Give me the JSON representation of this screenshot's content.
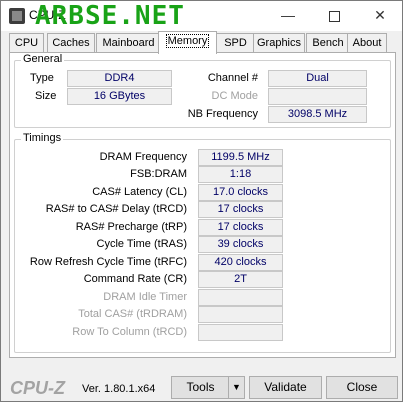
{
  "window": {
    "title": "CPU-Z",
    "watermark": "ARBSE.NET",
    "controls": {
      "minimize": "—",
      "close": "✕"
    }
  },
  "tabs": [
    {
      "label": "CPU"
    },
    {
      "label": "Caches"
    },
    {
      "label": "Mainboard"
    },
    {
      "label": "Memory"
    },
    {
      "label": "SPD"
    },
    {
      "label": "Graphics"
    },
    {
      "label": "Bench"
    },
    {
      "label": "About"
    }
  ],
  "active_tab": "Memory",
  "general": {
    "title": "General",
    "type_label": "Type",
    "type_value": "DDR4",
    "size_label": "Size",
    "size_value": "16 GBytes",
    "channel_label": "Channel #",
    "channel_value": "Dual",
    "dcmode_label": "DC Mode",
    "dcmode_value": "",
    "nbfreq_label": "NB Frequency",
    "nbfreq_value": "3098.5 MHz"
  },
  "timings": {
    "title": "Timings",
    "rows": [
      {
        "label": "DRAM Frequency",
        "value": "1199.5 MHz",
        "enabled": true
      },
      {
        "label": "FSB:DRAM",
        "value": "1:18",
        "enabled": true
      },
      {
        "label": "CAS# Latency (CL)",
        "value": "17.0 clocks",
        "enabled": true
      },
      {
        "label": "RAS# to CAS# Delay (tRCD)",
        "value": "17 clocks",
        "enabled": true
      },
      {
        "label": "RAS# Precharge (tRP)",
        "value": "17 clocks",
        "enabled": true
      },
      {
        "label": "Cycle Time (tRAS)",
        "value": "39 clocks",
        "enabled": true
      },
      {
        "label": "Row Refresh Cycle Time (tRFC)",
        "value": "420 clocks",
        "enabled": true
      },
      {
        "label": "Command Rate (CR)",
        "value": "2T",
        "enabled": true
      },
      {
        "label": "DRAM Idle Timer",
        "value": "",
        "enabled": false
      },
      {
        "label": "Total CAS# (tRDRAM)",
        "value": "",
        "enabled": false
      },
      {
        "label": "Row To Column (tRCD)",
        "value": "",
        "enabled": false
      }
    ]
  },
  "footer": {
    "logo": "CPU-Z",
    "version": "Ver. 1.80.1.x64",
    "tools_label": "Tools",
    "validate_label": "Validate",
    "close_label": "Close"
  }
}
